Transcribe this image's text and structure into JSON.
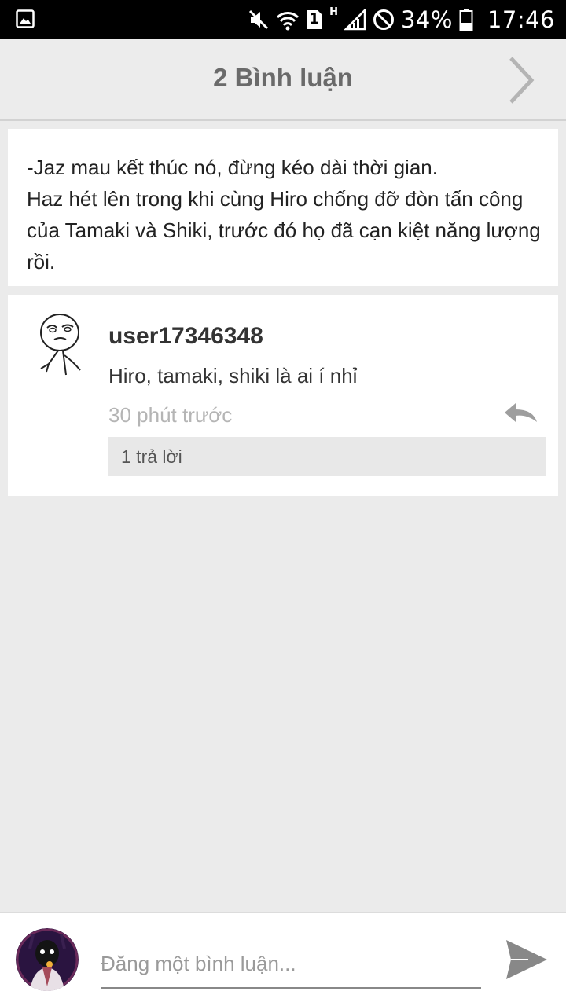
{
  "status_bar": {
    "left_icon": "gallery-icon",
    "icons": [
      "mute-icon",
      "wifi-icon",
      "sim-1-icon",
      "h-network-icon",
      "signal-icon",
      "blocked-icon",
      "battery-icon"
    ],
    "sim_slot": "1",
    "network_type": "H",
    "battery_percent": "34%",
    "time": "17:46"
  },
  "header": {
    "title": "2 Bình luận",
    "next_icon": "chevron-right-icon"
  },
  "post": {
    "text": "-Jaz mau kết thúc nó, đừng kéo dài thời gian.\nHaz hét lên trong khi cùng Hiro chống đỡ đòn tấn công của Tamaki và Shiki, trước đó họ đã cạn kiệt năng lượng rồi."
  },
  "comments": [
    {
      "username": "user17346348",
      "text": "Hiro, tamaki, shiki là ai í nhỉ",
      "time": "30 phút trước",
      "replies_label": "1 trả lời",
      "avatar_icon": "rage-face-avatar",
      "reply_icon": "reply-icon"
    }
  ],
  "input_bar": {
    "placeholder": "Đăng một bình luận...",
    "value": "",
    "avatar_icon": "user-avatar",
    "send_icon": "send-icon"
  },
  "colors": {
    "background": "#ebebeb",
    "header_bg": "#ececec",
    "card_bg": "#ffffff",
    "title_text": "#6a6a6a",
    "muted_text": "#b5b5b5",
    "replies_bg": "#e8e8e8"
  }
}
